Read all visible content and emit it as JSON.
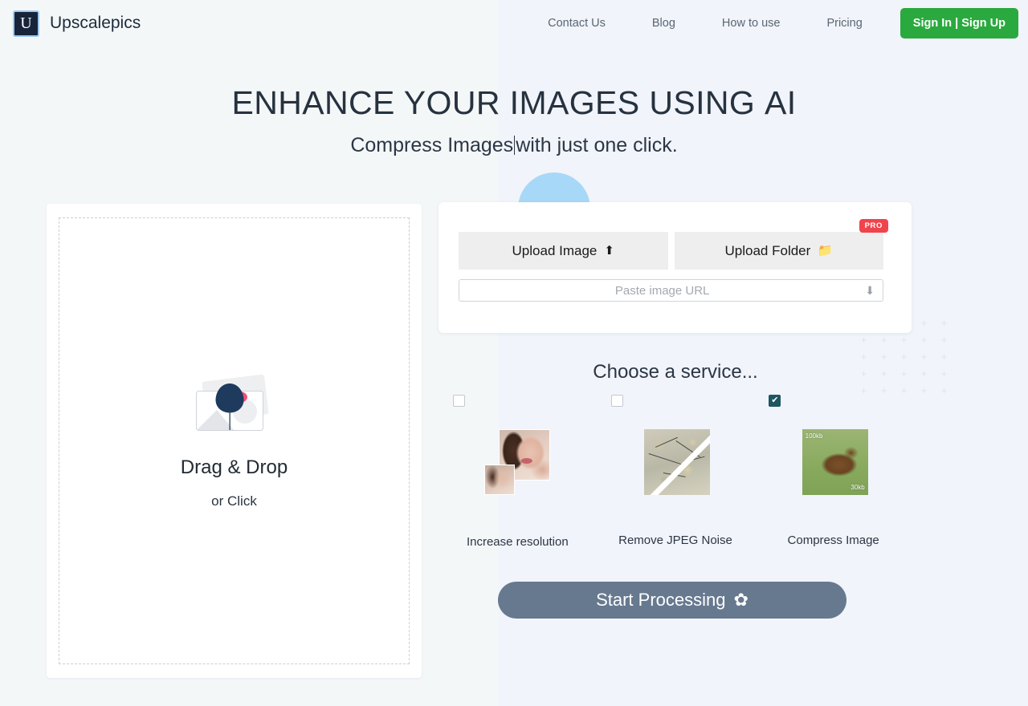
{
  "brand": {
    "logo_letter": "U",
    "name": "Upscalepics"
  },
  "nav": {
    "links": [
      {
        "label": "Contact Us"
      },
      {
        "label": "Blog"
      },
      {
        "label": "How to use"
      },
      {
        "label": "Pricing"
      }
    ],
    "cta_label": "Sign In | Sign Up",
    "cta_color": "#2aa93e"
  },
  "hero": {
    "title_main": "ENHANCE YOUR IMAGES USING ",
    "title_accent": "AI",
    "subtitle_before": "Compress Images",
    "subtitle_after": "with just one click."
  },
  "dropzone": {
    "title": "Drag & Drop",
    "subtitle": "or Click"
  },
  "upload": {
    "image_button_label": "Upload Image",
    "image_button_icon": "upload-icon",
    "folder_button_label": "Upload Folder",
    "folder_button_icon": "folder-icon",
    "pro_badge": "PRO",
    "pro_badge_color": "#f0444c",
    "url_placeholder": "Paste image URL",
    "url_value": "",
    "url_icon": "download-icon"
  },
  "services": {
    "heading": "Choose a service...",
    "checked_color": "#1e5662",
    "items": [
      {
        "label": "Increase resolution",
        "checked": false,
        "thumb": "portrait-upscale-thumbnail"
      },
      {
        "label": "Remove JPEG Noise",
        "checked": false,
        "thumb": "noisy-branches-thumbnail"
      },
      {
        "label": "Compress Image",
        "checked": true,
        "thumb": "bear-compress-thumbnail",
        "thumb_label_before": "100kb",
        "thumb_label_after": "30kb"
      }
    ]
  },
  "start": {
    "label": "Start Processing",
    "icon": "gear-icon",
    "color": "#67798f"
  }
}
